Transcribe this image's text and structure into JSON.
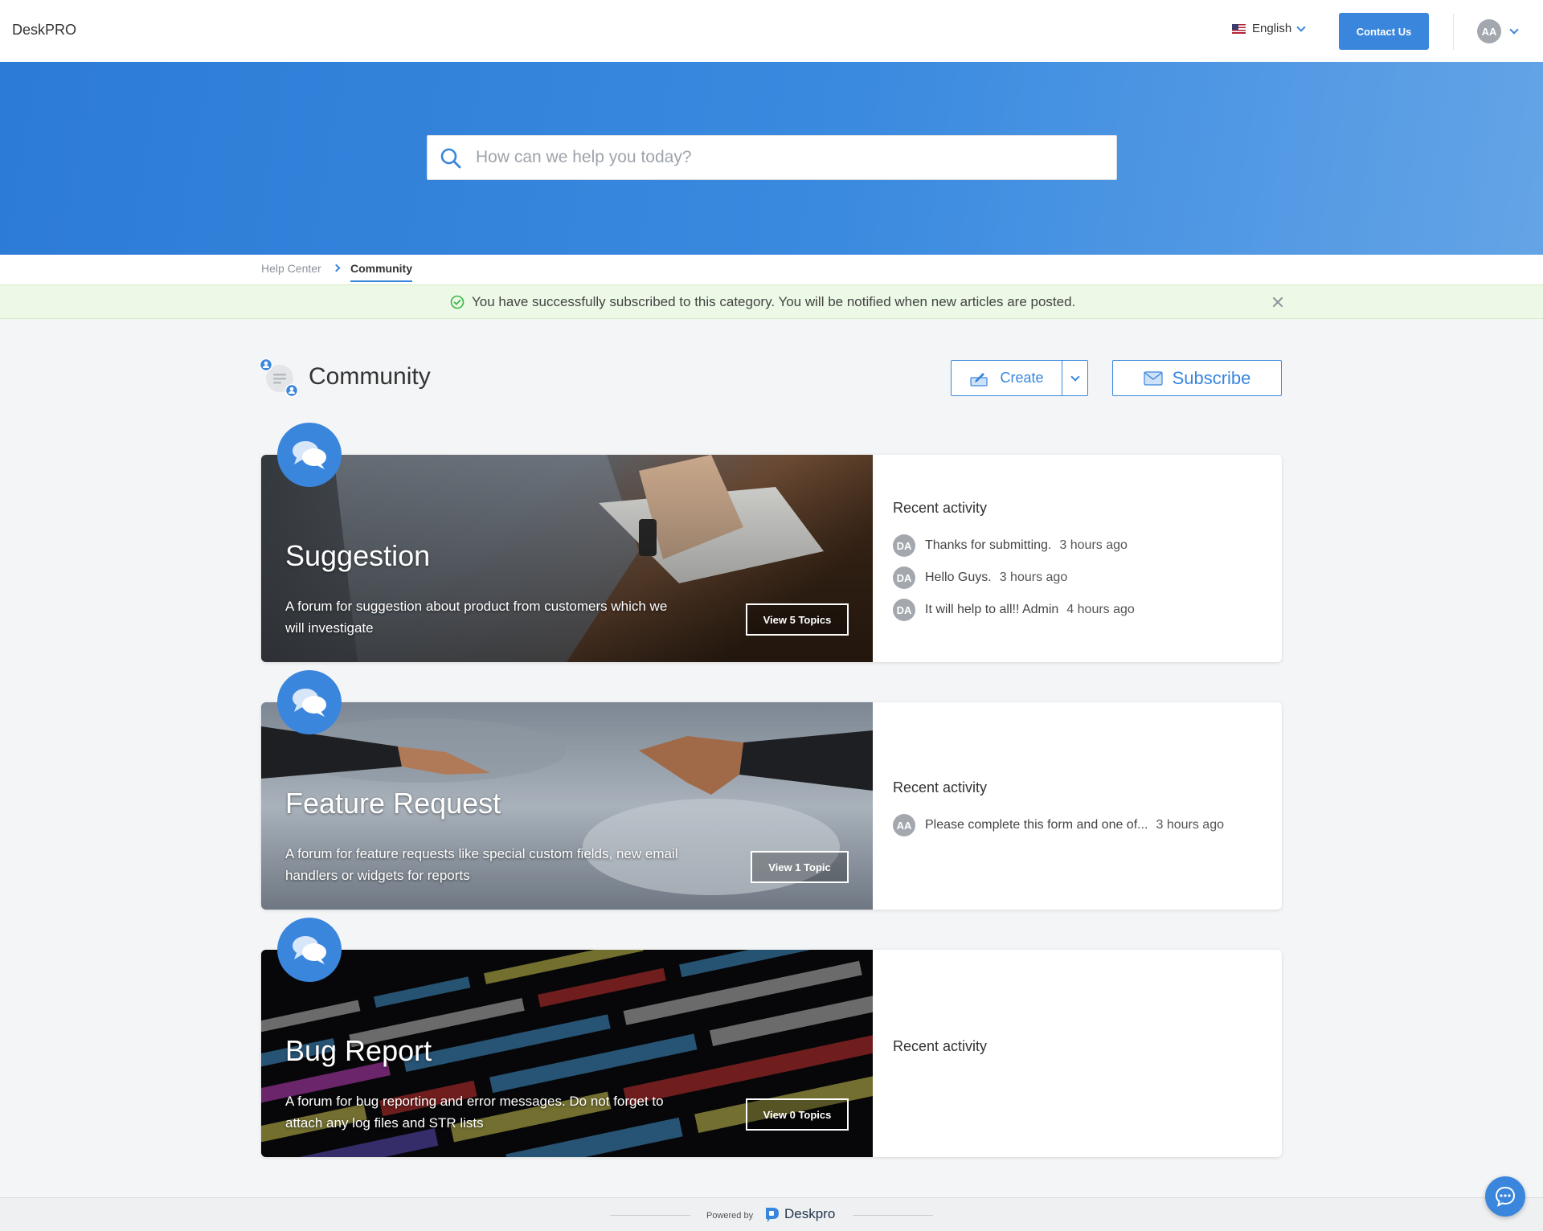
{
  "header": {
    "brand": "DeskPRO",
    "language": "English",
    "contact_label": "Contact Us",
    "user_initials": "AA"
  },
  "search": {
    "placeholder": "How can we help you today?"
  },
  "breadcrumb": {
    "home": "Help Center",
    "current": "Community"
  },
  "notice": {
    "text": "You have successfully subscribed to this category. You will be notified when new articles are posted."
  },
  "page": {
    "title": "Community",
    "create_label": "Create",
    "subscribe_label": "Subscribe"
  },
  "forums": [
    {
      "title": "Suggestion",
      "description": "A forum for suggestion about product from customers which we will investigate",
      "view_label": "View 5 Topics",
      "activity_title": "Recent activity",
      "activity": [
        {
          "initials": "DA",
          "text": "Thanks for submitting.",
          "time": "3 hours ago"
        },
        {
          "initials": "DA",
          "text": "Hello Guys.",
          "time": "3 hours ago"
        },
        {
          "initials": "DA",
          "text": "It will help to all!! Admin",
          "time": "4 hours ago"
        }
      ]
    },
    {
      "title": "Feature Request",
      "description": "A forum for feature requests like special custom fields, new email handlers or widgets for reports",
      "view_label": "View 1 Topic",
      "activity_title": "Recent activity",
      "activity": [
        {
          "initials": "AA",
          "text": "Please complete this form and one of...",
          "time": "3 hours ago"
        }
      ]
    },
    {
      "title": "Bug Report",
      "description": "A forum for bug reporting and error messages. Do not forget to attach any log files and STR lists",
      "view_label": "View 0 Topics",
      "activity_title": "Recent activity",
      "activity": []
    }
  ],
  "footer": {
    "powered_by": "Powered by",
    "logo_text": "Deskpro"
  },
  "colors": {
    "accent": "#3a86dd",
    "notice_bg": "#ecf9e6",
    "success": "#3bb54a"
  },
  "icons": {
    "search": "search-icon",
    "check": "check-circle-icon",
    "forum": "chat-bubbles-icon",
    "chat": "chat-icon"
  }
}
